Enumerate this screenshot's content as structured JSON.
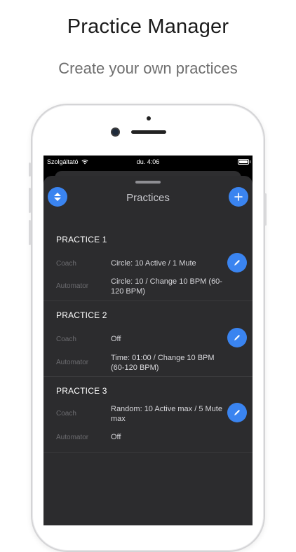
{
  "headline": "Practice Manager",
  "subline": "Create your own practices",
  "status": {
    "carrier": "Szolgáltató",
    "time": "du. 4:06"
  },
  "sheet": {
    "title": "Practices"
  },
  "labels": {
    "coach": "Coach",
    "automator": "Automator"
  },
  "practices": [
    {
      "title": "PRACTICE 1",
      "coach": "Circle: 10 Active / 1 Mute",
      "automator": "Circle: 10 / Change 10 BPM (60-120 BPM)"
    },
    {
      "title": "PRACTICE 2",
      "coach": "Off",
      "automator": "Time: 01:00 / Change 10 BPM (60-120 BPM)"
    },
    {
      "title": "PRACTICE 3",
      "coach": "Random: 10 Active max / 5 Mute max",
      "automator": "Off"
    }
  ],
  "colors": {
    "accent": "#3a84f0",
    "sheet": "#2c2c2e",
    "screen": "#000000"
  },
  "icons": {
    "sort": "sort-icon",
    "add": "plus-icon",
    "edit": "pencil-icon",
    "wifi": "wifi-icon",
    "battery": "battery-icon"
  }
}
